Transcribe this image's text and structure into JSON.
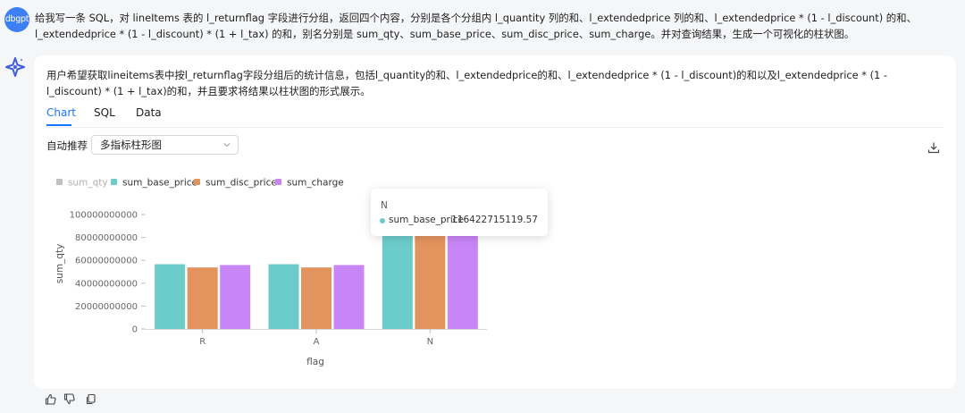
{
  "user_message": {
    "avatar_label": "dbgpt",
    "text": "给我写一条 SQL，对 lineItems 表的 l_returnflag 字段进行分组，返回四个内容，分别是各个分组内 l_quantity 列的和、l_extendedprice 列的和、l_extendedprice * (1 - l_discount) 的和、l_extendedprice * (1 - l_discount) * (1 + l_tax) 的和，别名分别是 sum_qty、sum_base_price、sum_disc_price、sum_charge。并对查询结果，生成一个可视化的柱状图。"
  },
  "answer": {
    "bot_icon": "sparkle-logo-icon",
    "text": "用户希望获取lineitems表中按l_returnflag字段分组后的统计信息，包括l_quantity的和、l_extendedprice的和、l_extendedprice * (1 - l_discount)的和以及l_extendedprice * (1 - l_discount) * (1 + l_tax)的和，并且要求将结果以柱状图的形式展示。",
    "tabs": [
      {
        "label": "Chart",
        "active": true
      },
      {
        "label": "SQL",
        "active": false
      },
      {
        "label": "Data",
        "active": false
      }
    ],
    "recommend_label": "自动推荐",
    "chart_type_selected": "多指标柱形图",
    "download_icon": "download-icon"
  },
  "tooltip": {
    "title": "N",
    "series": "sum_base_price",
    "value": "116422715119.57",
    "color": "#6ccccb"
  },
  "chart_data": {
    "type": "bar",
    "categories": [
      "R",
      "A",
      "N"
    ],
    "series": [
      {
        "name": "sum_qty",
        "values": [
          null,
          null,
          null
        ],
        "color": "#c0c0c0",
        "hidden": true
      },
      {
        "name": "sum_base_price",
        "values": [
          56600000000,
          56600000000,
          116422715119.57
        ],
        "color": "#6ccccb"
      },
      {
        "name": "sum_disc_price",
        "values": [
          53800000000,
          53800000000,
          110600000000
        ],
        "color": "#e3945e"
      },
      {
        "name": "sum_charge",
        "values": [
          55900000000,
          55900000000,
          115000000000
        ],
        "color": "#c885f6"
      }
    ],
    "xlabel": "flag",
    "ylabel": "sum_qty",
    "yticks": [
      0,
      20000000000,
      40000000000,
      60000000000,
      80000000000,
      100000000000
    ],
    "ylim": [
      0,
      116422715119.57
    ],
    "legend_position": "top-left",
    "grid": true
  },
  "footer_actions": [
    {
      "icon": "thumbs-up-icon"
    },
    {
      "icon": "thumbs-down-icon"
    },
    {
      "icon": "copy-icon"
    }
  ]
}
